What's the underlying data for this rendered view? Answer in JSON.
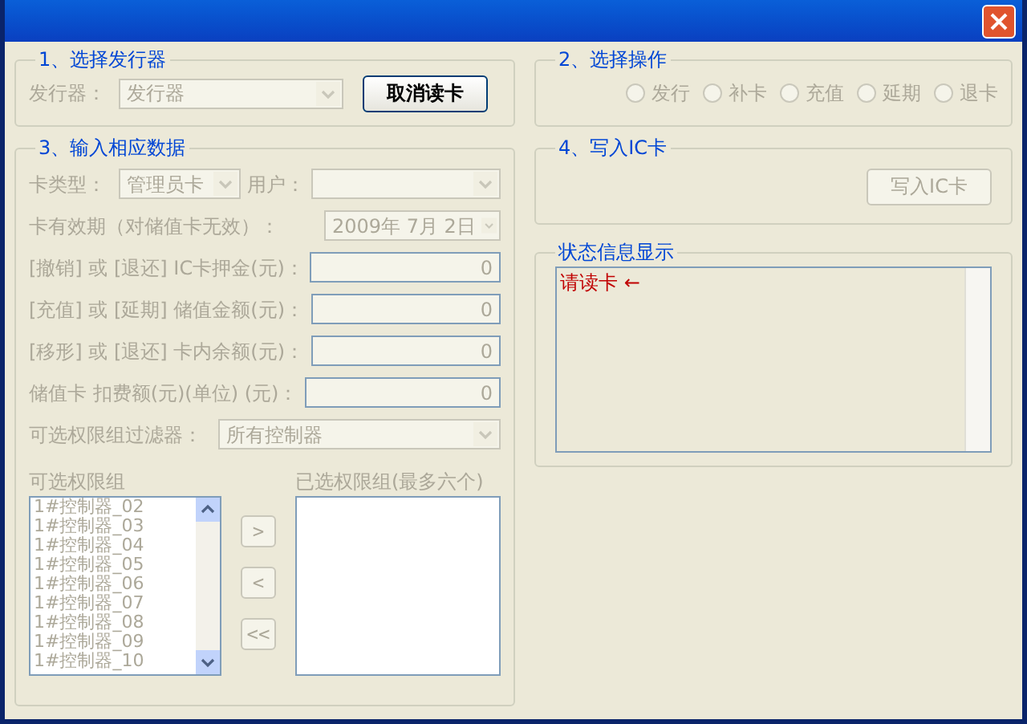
{
  "reader_group": {
    "title": "1、选择发行器",
    "label": "发行器：",
    "select": {
      "value": "发行器",
      "disabled": true
    },
    "button": {
      "label": "取消读卡",
      "disabled": false
    }
  },
  "operation_group": {
    "title": "2、选择操作",
    "options": [
      {
        "label": "发行",
        "selected": false,
        "disabled": true
      },
      {
        "label": "补卡",
        "selected": false,
        "disabled": true
      },
      {
        "label": "充值",
        "selected": false,
        "disabled": true
      },
      {
        "label": "延期",
        "selected": false,
        "disabled": true
      },
      {
        "label": "退卡",
        "selected": false,
        "disabled": true
      }
    ]
  },
  "data_group": {
    "title": "3、输入相应数据",
    "card_type": {
      "label": "卡类型：",
      "value": "管理员卡",
      "disabled": true
    },
    "user": {
      "label": "用户：",
      "disabled": true
    },
    "validity": {
      "label": "卡有效期（对储值卡无效）：",
      "value": "2009年 7月 2日",
      "disabled": true
    },
    "amounts": [
      {
        "label": "[撤销] 或 [退还] IC卡押金(元)：",
        "value": "0",
        "disabled": true
      },
      {
        "label": "[充值] 或 [延期] 储值金额(元)：",
        "value": "0",
        "disabled": true
      },
      {
        "label": "[移形] 或 [退还] 卡内余额(元)：",
        "value": "0",
        "disabled": true
      },
      {
        "label": "储值卡 扣费额(元)(单位) (元)：",
        "value": "0",
        "disabled": true
      }
    ],
    "filter": {
      "label": "可选权限组过滤器：",
      "value": "所有控制器",
      "disabled": true
    },
    "available": {
      "title": "可选权限组",
      "disabled": true,
      "items": [
        "1#控制器_02",
        "1#控制器_03",
        "1#控制器_04",
        "1#控制器_05",
        "1#控制器_06",
        "1#控制器_07",
        "1#控制器_08",
        "1#控制器_09",
        "1#控制器_10"
      ]
    },
    "move_buttons": [
      {
        "label": ">",
        "disabled": true
      },
      {
        "label": "<",
        "disabled": true
      },
      {
        "label": "<<",
        "disabled": true
      }
    ],
    "chosen": {
      "title": "已选权限组(最多六个)"
    }
  },
  "write_group": {
    "title": "4、写入IC卡",
    "button": {
      "label": "写入IC卡",
      "disabled": true
    }
  },
  "status_group": {
    "title": "状态信息显示",
    "message": "请读卡 ←"
  }
}
